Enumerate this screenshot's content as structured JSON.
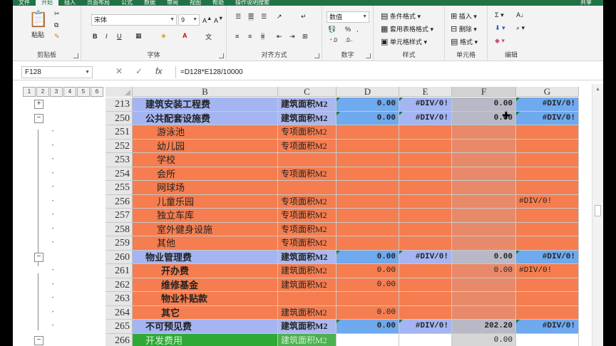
{
  "ribbon": {
    "tabs": [
      "文件",
      "开始",
      "插入",
      "页面布局",
      "公式",
      "数据",
      "审阅",
      "视图",
      "帮助",
      "操作说明搜索"
    ],
    "active_tab": "开始",
    "share": "共享",
    "clipboard": {
      "paste": "粘贴",
      "label": "剪贴板"
    },
    "font": {
      "name": "宋体",
      "size": "9",
      "bold": "B",
      "italic": "I",
      "underline": "U",
      "label": "字体"
    },
    "alignment": {
      "label": "对齐方式"
    },
    "number": {
      "format": "数值",
      "label": "数字"
    },
    "styles": {
      "cond": "条件格式",
      "table": "套用表格格式",
      "cell": "单元格样式",
      "label": "样式"
    },
    "cells": {
      "insert": "插入",
      "delete": "删除",
      "format": "格式",
      "label": "单元格"
    },
    "editing": {
      "label": "编辑"
    }
  },
  "formula_bar": {
    "name_box": "F128",
    "formula": "=D128*E128/10000"
  },
  "outline_levels": [
    "1",
    "2",
    "3",
    "4",
    "5",
    "6"
  ],
  "columns": [
    "B",
    "C",
    "D",
    "E",
    "F",
    "G"
  ],
  "selected_column": "F",
  "rows": [
    {
      "num": "213",
      "type": "blue",
      "b": "建筑安装工程费",
      "c": "建筑面积M2",
      "d": "0.00",
      "e": "#DIV/0!",
      "f": "0.00",
      "g": "#DIV/0!",
      "bold": true,
      "outline": "+"
    },
    {
      "num": "250",
      "type": "blue",
      "b": "公共配套设施费",
      "c": "建筑面积M2",
      "d": "0.00",
      "e": "#DIV/0!",
      "f": "0.00",
      "g": "#DIV/0!",
      "bold": true,
      "outline": "−"
    },
    {
      "num": "251",
      "type": "orange",
      "b": "游泳池",
      "c": "专项面积M2",
      "d": "",
      "e": "",
      "f": "",
      "g": ""
    },
    {
      "num": "252",
      "type": "orange",
      "b": "幼儿园",
      "c": "专项面积M2",
      "d": "",
      "e": "",
      "f": "",
      "g": ""
    },
    {
      "num": "253",
      "type": "orange",
      "b": "学校",
      "c": "",
      "d": "",
      "e": "",
      "f": "",
      "g": ""
    },
    {
      "num": "254",
      "type": "orange",
      "b": "会所",
      "c": "专项面积M2",
      "d": "",
      "e": "",
      "f": "",
      "g": ""
    },
    {
      "num": "255",
      "type": "orange",
      "b": "网球场",
      "c": "",
      "d": "",
      "e": "",
      "f": "",
      "g": ""
    },
    {
      "num": "256",
      "type": "orange",
      "b": "儿童乐园",
      "c": "专项面积M2",
      "d": "",
      "e": "",
      "f": "",
      "g": "#DIV/0!"
    },
    {
      "num": "257",
      "type": "orange",
      "b": "独立车库",
      "c": "专项面积M2",
      "d": "",
      "e": "",
      "f": "",
      "g": ""
    },
    {
      "num": "258",
      "type": "orange",
      "b": "室外健身设施",
      "c": "专项面积M2",
      "d": "",
      "e": "",
      "f": "",
      "g": ""
    },
    {
      "num": "259",
      "type": "orange",
      "b": "其他",
      "c": "专项面积M2",
      "d": "",
      "e": "",
      "f": "",
      "g": ""
    },
    {
      "num": "260",
      "type": "blue",
      "b": "物业管理费",
      "c": "建筑面积M2",
      "d": "0.00",
      "e": "#DIV/0!",
      "f": "0.00",
      "g": "#DIV/0!",
      "bold": true,
      "outline": "−"
    },
    {
      "num": "261",
      "type": "orange",
      "b": "开办费",
      "c": "建筑面积M2",
      "d": "0.00",
      "e": "",
      "f": "0.00",
      "g": "#DIV/0!",
      "bold": true,
      "indent": true
    },
    {
      "num": "262",
      "type": "orange",
      "b": "维修基金",
      "c": "建筑面积M2",
      "d": "0.00",
      "e": "",
      "f": "",
      "g": "",
      "bold": true,
      "indent": true
    },
    {
      "num": "263",
      "type": "orange",
      "b": "物业补贴款",
      "c": "",
      "d": "",
      "e": "",
      "f": "",
      "g": "",
      "bold": true,
      "indent": true
    },
    {
      "num": "264",
      "type": "orange",
      "b": "其它",
      "c": "建筑面积M2",
      "d": "0.00",
      "e": "",
      "f": "",
      "g": "",
      "bold": true,
      "indent": true
    },
    {
      "num": "265",
      "type": "blue",
      "b": "不可预见费",
      "c": "建筑面积M2",
      "d": "0.00",
      "e": "#DIV/0!",
      "f": "202.20",
      "g": "#DIV/0!",
      "bold": true
    },
    {
      "num": "266",
      "type": "green",
      "b": "开发费用",
      "c": "建筑面积M2",
      "d": "",
      "e": "",
      "f": "0.00",
      "g": "",
      "outline": "−"
    }
  ]
}
